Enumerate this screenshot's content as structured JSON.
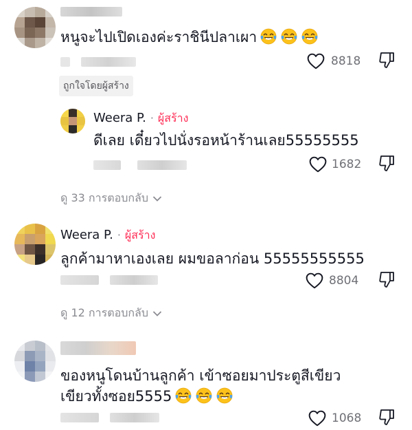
{
  "comments": [
    {
      "text": "หนูจะไปเปิดเองค่ะราชินีปลาเผา",
      "emoji_count": 3,
      "likes": "8818",
      "liked_by_creator": "ถูกใจโดยผู้สร้าง"
    },
    {
      "author": "Weera P.",
      "separator": "·",
      "creator_label": "ผู้สร้าง",
      "text": "ดีเลย เดี๋ยวไปนั่งรอหน้าร้านเลย55555555",
      "likes": "1682"
    },
    {
      "replies_label": "ดู 33 การตอบกลับ"
    },
    {
      "author": "Weera P.",
      "separator": "·",
      "creator_label": "ผู้สร้าง",
      "text": "ลูกค้ามาหาเองเลย ผมขอลาก่อน 55555555555",
      "likes": "8804"
    },
    {
      "replies_label": "ดู 12 การตอบกลับ"
    },
    {
      "text_line1": "ของหนูโดนบ้านลูกค้า เข้าซอยมาประตูสีเขียว",
      "text_line2": "เขียวทั้งซอย5555",
      "emoji_count": 3,
      "likes": "1068"
    }
  ],
  "icons": {
    "like": "heart-outline-icon",
    "dislike": "thumbs-down-icon",
    "chevron": "chevron-down-icon",
    "emoji": "tears-of-joy-emoji"
  },
  "colors": {
    "creator": "#fe2c55",
    "muted": "#8a8b91",
    "text": "#161823"
  }
}
